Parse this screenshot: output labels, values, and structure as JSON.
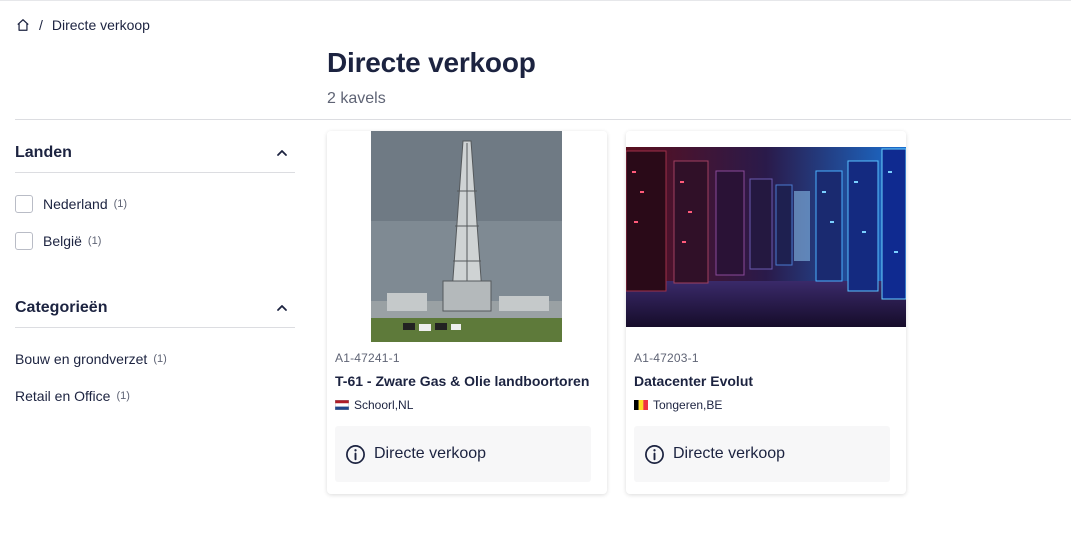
{
  "breadcrumb": {
    "home_icon": "home-icon",
    "separator": "/",
    "current": "Directe verkoop"
  },
  "header": {
    "title": "Directe verkoop",
    "count": "2 kavels"
  },
  "filters": {
    "countries": {
      "title": "Landen",
      "items": [
        {
          "label": "Nederland",
          "count": "(1)"
        },
        {
          "label": "België",
          "count": "(1)"
        }
      ]
    },
    "categories": {
      "title": "Categorieën",
      "items": [
        {
          "label": "Bouw en grondverzet",
          "count": "(1)"
        },
        {
          "label": "Retail en Office",
          "count": "(1)"
        }
      ]
    }
  },
  "lots": [
    {
      "id": "A1-47241-1",
      "title": "T-61 - Zware Gas & Olie landboortoren",
      "location": "Schoorl,NL",
      "flag": "flag-nl",
      "action": "Directe verkoop"
    },
    {
      "id": "A1-47203-1",
      "title": "Datacenter Evolut",
      "location": "Tongeren,BE",
      "flag": "flag-be",
      "action": "Directe verkoop"
    }
  ],
  "colors": {
    "text": "#1c2340",
    "muted": "#5f6475",
    "divider": "#dcdde1",
    "action_bg": "#f7f7f8"
  }
}
